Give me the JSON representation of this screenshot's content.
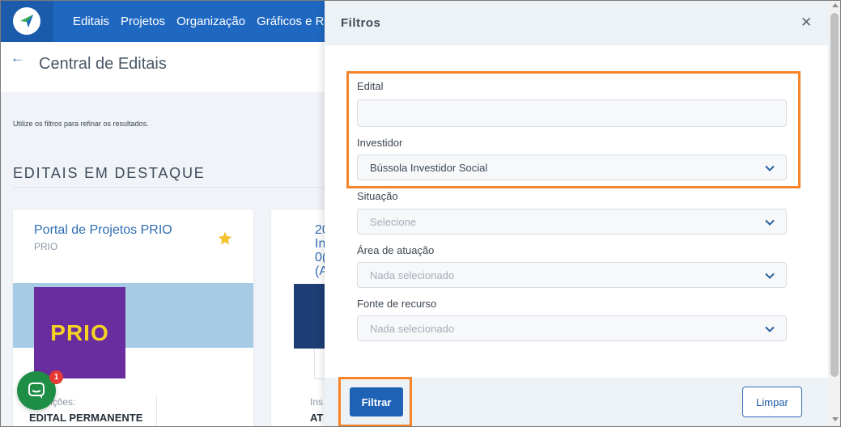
{
  "nav": {
    "items": [
      "Editais",
      "Projetos",
      "Organização",
      "Gráficos e Rel"
    ]
  },
  "page": {
    "back_icon": "arrow-left-icon",
    "title": "Central de Editais",
    "hint": "Utilize os filtros para refinar os resultados.",
    "section_title": "EDITAIS EM DESTAQUE"
  },
  "cards": [
    {
      "title": "Portal de Projetos PRIO",
      "subtitle": "PRIO",
      "logo_text": "PRIO",
      "inscricoes_label": "ições:",
      "inscricoes_value": "EDITAL PERMANENTE"
    },
    {
      "title": "20 In 0( (A",
      "inscricoes_label": "Ins",
      "inscricoes_value": "AT"
    }
  ],
  "chat": {
    "badge": "1"
  },
  "filters": {
    "title": "Filtros",
    "close_icon": "close-icon",
    "edital": {
      "label": "Edital",
      "value": ""
    },
    "investidor": {
      "label": "Investidor",
      "value": "Bússola Investidor Social"
    },
    "situacao": {
      "label": "Situação",
      "placeholder": "Selecione"
    },
    "area": {
      "label": "Área de atuação",
      "placeholder": "Nada selecionado"
    },
    "fonte": {
      "label": "Fonte de recurso",
      "placeholder": "Nada selecionado"
    },
    "filtrar_label": "Filtrar",
    "limpar_label": "Limpar"
  },
  "colors": {
    "nav": "#1f68c1",
    "highlight": "#f5842a",
    "primary_button": "#1d62b4",
    "prio_purple": "#6a2d9f",
    "prio_yellow": "#f4d321",
    "chat_green": "#1e8e46"
  }
}
